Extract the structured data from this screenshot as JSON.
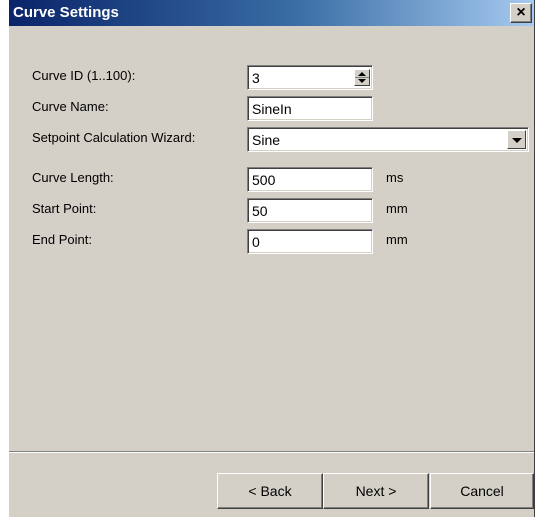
{
  "window": {
    "title": "Curve Settings",
    "close_glyph": "✕",
    "colors": {
      "titlebar_start": "#0a246a",
      "titlebar_end": "#a6caf0",
      "face": "#d4d0c8"
    }
  },
  "form": {
    "curve_id": {
      "label": "Curve ID (1..100):",
      "value": "3"
    },
    "curve_name": {
      "label": "Curve Name:",
      "value": "SineIn"
    },
    "wizard": {
      "label": "Setpoint Calculation Wizard:",
      "value": "Sine"
    },
    "curve_length": {
      "label": "Curve Length:",
      "value": "500",
      "unit": "ms"
    },
    "start_point": {
      "label": "Start Point:",
      "value": "50",
      "unit": "mm"
    },
    "end_point": {
      "label": "End Point:",
      "value": "0",
      "unit": "mm"
    }
  },
  "buttons": {
    "back": "< Back",
    "next": "Next >",
    "cancel": "Cancel"
  }
}
